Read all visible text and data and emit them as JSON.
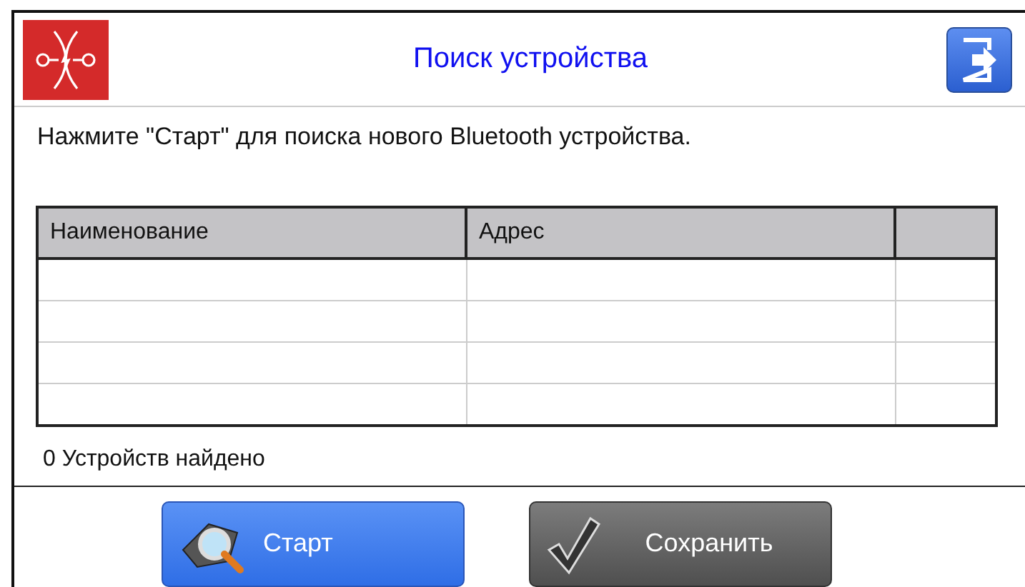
{
  "header": {
    "title": "Поиск устройства"
  },
  "instruction": "Нажмите \"Старт\" для поиска нового Bluetooth устройства.",
  "table": {
    "columns": [
      "Наименование",
      "Адрес"
    ]
  },
  "status": "0 Устройств найдено",
  "buttons": [
    {
      "label": "Старт",
      "kind": "search"
    },
    {
      "label": "Сохранить",
      "kind": "save"
    }
  ]
}
